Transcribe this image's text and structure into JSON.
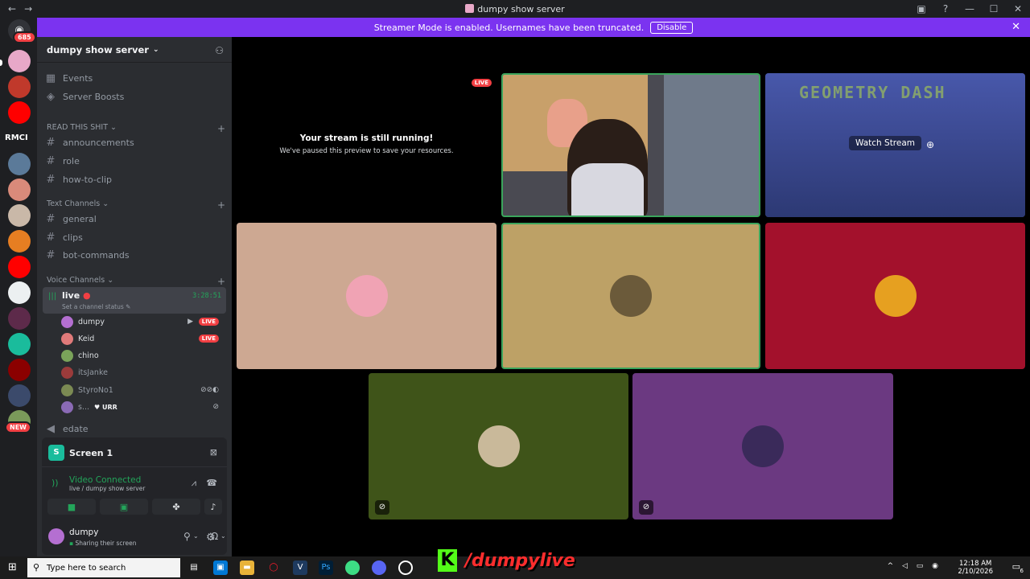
{
  "window": {
    "title": "dumpy show server",
    "nav_back": "←",
    "nav_fwd": "→"
  },
  "banner": {
    "text": "Streamer Mode is enabled. Usernames have been truncated.",
    "button": "Disable"
  },
  "server_rail": {
    "home_badge": "685",
    "text_icon": "RMCI",
    "new_badge": "NEW"
  },
  "sidebar": {
    "server_name": "dumpy show server",
    "top_items": [
      {
        "label": "Events",
        "icon": "calendar-icon"
      },
      {
        "label": "Server Boosts",
        "icon": "boost-icon"
      }
    ],
    "categories": [
      {
        "name": "READ THIS SHIT",
        "channels": [
          "announcements",
          "role",
          "how-to-clip"
        ]
      },
      {
        "name": "Text Channels",
        "channels": [
          "general",
          "clips",
          "bot-commands"
        ]
      },
      {
        "name": "Voice Channels"
      }
    ],
    "voice_channel": {
      "name": "live",
      "timer": "3:28:51",
      "status": "Set a channel status"
    },
    "voice_users": [
      {
        "name": "dumpy",
        "live": "LIVE",
        "color": "#b46fd1"
      },
      {
        "name": "Keid",
        "live": "LIVE",
        "color": "#e07a7a"
      },
      {
        "name": "chino",
        "color": "#7aa35a"
      },
      {
        "name": "itsJanke",
        "color": "#9b3b3b"
      },
      {
        "name": "StyroNo1",
        "color": "#7b8a53"
      },
      {
        "name": "s...",
        "extra": "URR",
        "color": "#8a6ab5"
      }
    ],
    "other_voice": "edate"
  },
  "voice_panel": {
    "screen_label": "Screen 1",
    "connected": "Video Connected",
    "location": "live / dumpy show server",
    "user_name": "dumpy",
    "user_status": "Sharing their screen"
  },
  "stage": {
    "paused_title": "Your stream is still running!",
    "paused_sub": "We've paused this preview to save your resources.",
    "live_tag": "LIVE",
    "watch_stream": "Watch Stream",
    "game_title": "GEOMETRY DASH",
    "colors": {
      "tile_patrick": "#cda892",
      "tile_cowboy": "#bda166",
      "tile_red": "#a3112c",
      "tile_green": "#3f5419",
      "tile_purple": "#6b3981",
      "speaking": "#3ba55c"
    }
  },
  "taskbar": {
    "search_placeholder": "Type here to search",
    "time": "12:18 AM",
    "date": "2/10/2026",
    "notif_count": "6"
  },
  "overlay": {
    "kick_letter": "K",
    "handle": "/dumpylive"
  }
}
